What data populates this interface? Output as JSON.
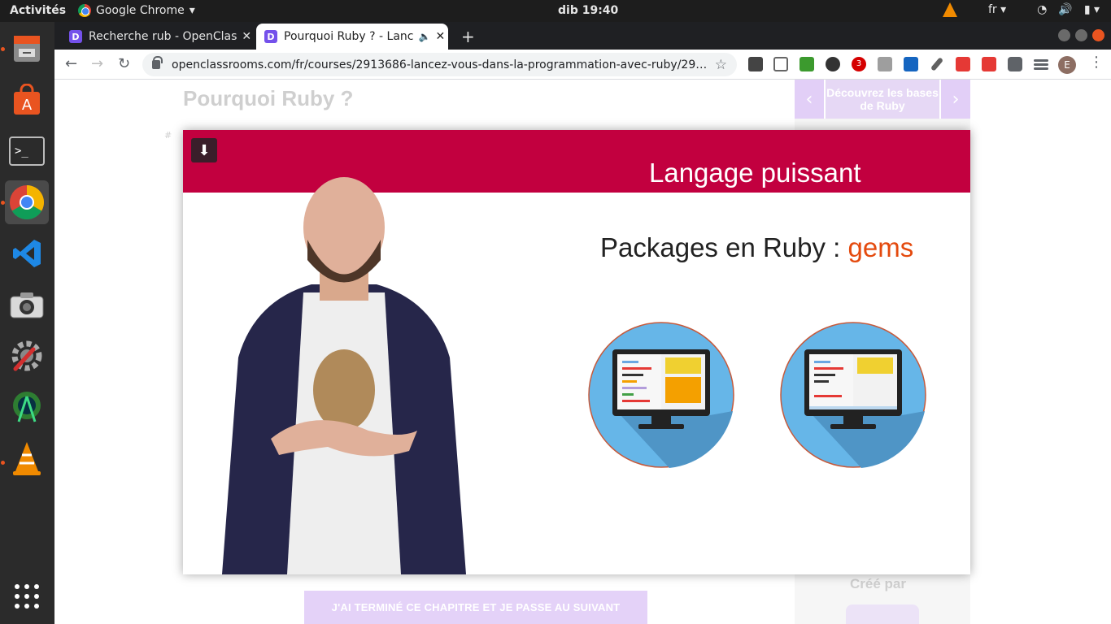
{
  "os": {
    "activities": "Activités",
    "app_name": "Google Chrome",
    "clock": "dib 19:40",
    "language": "fr"
  },
  "browser": {
    "tabs": [
      {
        "label": "Recherche rub - OpenClas",
        "active": false
      },
      {
        "label": "Pourquoi Ruby ? - Lanc",
        "active": true
      }
    ],
    "url": "openclassrooms.com/fr/courses/2913686-lancez-vous-dans-la-programmation-avec-ruby/2915051-pou...",
    "profile_initial": "E",
    "extension_badge": "3"
  },
  "page": {
    "title": "Pourquoi Ruby ?",
    "side_nav_label": "Découvrez les bases de Ruby",
    "created_by": "Créé par",
    "next_button": "J'AI TERMINÉ CE CHAPITRE ET JE PASSE AU SUIVANT",
    "hash": "#"
  },
  "video": {
    "slide_title": "Langage puissant",
    "subtitle_prefix": "Packages en Ruby : ",
    "subtitle_accent": "gems"
  },
  "colors": {
    "brand_red": "#c2003f",
    "accent_orange": "#e44a0e",
    "openclassrooms_purple": "#7451eb"
  }
}
